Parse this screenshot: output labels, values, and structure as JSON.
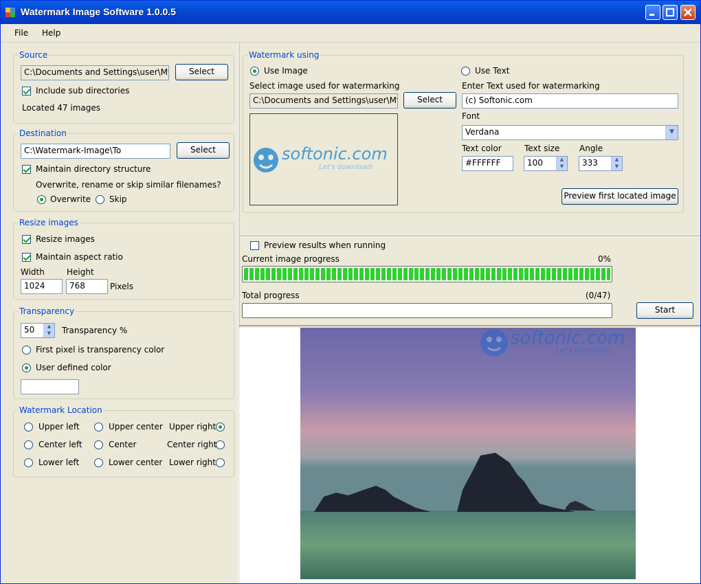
{
  "window": {
    "title": "Watermark Image Software 1.0.0.5"
  },
  "menu": {
    "file": "File",
    "help": "Help"
  },
  "source": {
    "legend": "Source",
    "path": "C:\\Documents and Settings\\user\\My",
    "select": "Select",
    "include_sub": "Include sub directories",
    "located": "Located 47 images"
  },
  "destination": {
    "legend": "Destination",
    "path": "C:\\Watermark-Image\\To",
    "select": "Select",
    "maintain": "Maintain directory structure",
    "question": "Overwrite, rename or skip similar filenames?",
    "overwrite": "Overwrite",
    "skip": "Skip"
  },
  "resize": {
    "legend": "Resize images",
    "resize_images": "Resize images",
    "aspect": "Maintain aspect ratio",
    "width_label": "Width",
    "height_label": "Height",
    "width": "1024",
    "height": "768",
    "pixels": "Pixels"
  },
  "transparency": {
    "legend": "Transparency",
    "value": "50",
    "label": "Transparency %",
    "first_pixel": "First pixel is transparency color",
    "user_defined": "User defined color"
  },
  "location": {
    "legend": "Watermark Location",
    "upper_left": "Upper left",
    "upper_center": "Upper center",
    "upper_right": "Upper right",
    "center_left": "Center left",
    "center": "Center",
    "center_right": "Center right",
    "lower_left": "Lower left",
    "lower_center": "Lower center",
    "lower_right": "Lower right"
  },
  "watermark": {
    "legend": "Watermark using",
    "use_image": "Use Image",
    "use_text": "Use Text",
    "select_image_label": "Select image used for watermarking",
    "image_path": "C:\\Documents and Settings\\user\\My",
    "select": "Select",
    "logo_text": "softonic.com",
    "logo_tagline": "Let's download!",
    "enter_text_label": "Enter Text used for watermarking",
    "text_value": "(c) Softonic.com",
    "font_label": "Font",
    "font_value": "Verdana",
    "text_color_label": "Text color",
    "text_color": "#FFFFFF",
    "text_size_label": "Text size",
    "text_size": "100",
    "angle_label": "Angle",
    "angle": "333",
    "preview_first": "Preview first located image"
  },
  "progress": {
    "preview_running": "Preview results when running",
    "current_label": "Current image progress",
    "current_pct": "0%",
    "current_fill": 1.0,
    "total_label": "Total progress",
    "total_count": "(0/47)",
    "total_fill": 0.0,
    "start": "Start"
  },
  "preview": {
    "logo_text": "softonic.com",
    "logo_tagline": "Let's download!"
  },
  "colors": {
    "accent": "#0046d5",
    "progress": "#2fd12f",
    "titlebar": "#0847d0"
  }
}
